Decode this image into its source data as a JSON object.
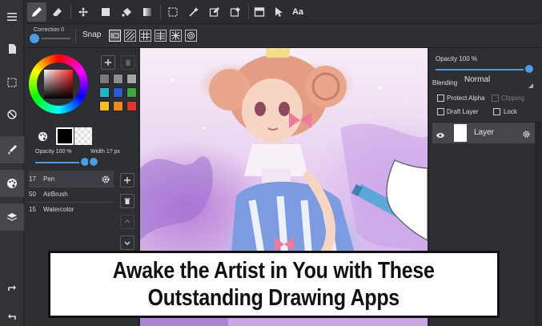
{
  "toolbar": {
    "aa_label": "Aa"
  },
  "subbar": {
    "correction_label": "Correction 0",
    "snap_label": "Snap"
  },
  "color_panel": {
    "swatches": [
      "#7a7a7a",
      "#8e8e8e",
      "#a7a7a7",
      "#c2c2c2",
      "#20b8c8",
      "#2c5ad6",
      "#3aa83e",
      "#a12bb6",
      "#f2c21c",
      "#f08a1a",
      "#e2362a",
      "#f7e62c"
    ],
    "opacity_label": "Opacity 100 %",
    "width_label": "Width 17 px",
    "opacity_value": 100,
    "width_value": 17
  },
  "brushes": [
    {
      "size": "17",
      "name": "Pen"
    },
    {
      "size": "50",
      "name": "AirBrush"
    },
    {
      "size": "15",
      "name": "Watercolor"
    }
  ],
  "layer_panel": {
    "opacity_label": "Opacity 100 %",
    "opacity_value": 100,
    "blending_label": "Blending",
    "blending_value": "Normal",
    "protect_alpha_label": "Protect Alpha",
    "clipping_label": "Clipping",
    "draft_layer_label": "Draft Layer",
    "lock_label": "Lock",
    "layer_name": "Layer"
  },
  "banner": {
    "line1": "Awake the Artist in You with These",
    "line2": "Outstanding Drawing Apps"
  },
  "colors": {
    "accent": "#4d9be0",
    "panel": "#2e2f32",
    "toolbar": "#2b2c2f"
  }
}
